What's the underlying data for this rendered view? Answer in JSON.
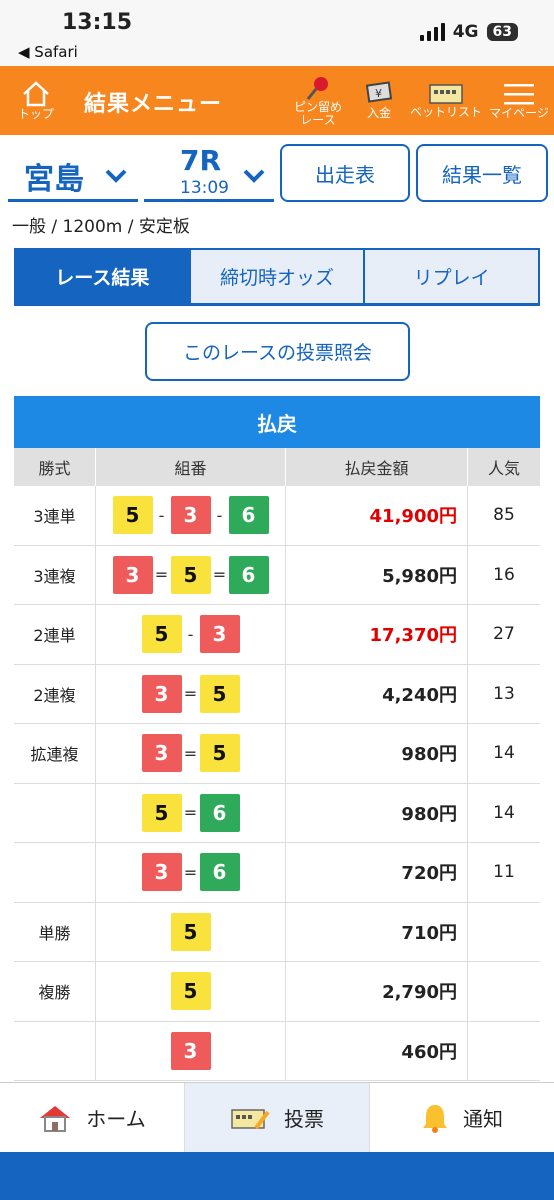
{
  "status": {
    "time": "13:15",
    "back": "◀ Safari",
    "network": "4G",
    "battery": "63"
  },
  "header": {
    "top": "トップ",
    "title": "結果メニュー",
    "pin": "ピン留め\nレース",
    "deposit": "入金",
    "betlist": "ベットリスト",
    "mypage": "マイページ"
  },
  "race": {
    "venue": "宮島",
    "race_no": "7R",
    "race_time": "13:09",
    "entries_button": "出走表",
    "results_button": "結果一覧",
    "info": "一般 / 1200m / 安定板"
  },
  "tabs": [
    "レース結果",
    "締切時オッズ",
    "リプレイ"
  ],
  "inquiry_button": "このレースの投票照会",
  "table": {
    "title": "払戻",
    "headers": [
      "勝式",
      "組番",
      "払戻金額",
      "人気"
    ],
    "rows": [
      {
        "type": "3連単",
        "combo": [
          "5",
          "-",
          "3",
          "-",
          "6"
        ],
        "amount": "41,900円",
        "pop": "85",
        "red": true
      },
      {
        "type": "3連複",
        "combo": [
          "3",
          "=",
          "5",
          "=",
          "6"
        ],
        "amount": "5,980円",
        "pop": "16",
        "red": false
      },
      {
        "type": "2連単",
        "combo": [
          "5",
          "-",
          "3"
        ],
        "amount": "17,370円",
        "pop": "27",
        "red": true
      },
      {
        "type": "2連複",
        "combo": [
          "3",
          "=",
          "5"
        ],
        "amount": "4,240円",
        "pop": "13",
        "red": false
      },
      {
        "type": "拡連複",
        "combo": [
          "3",
          "=",
          "5"
        ],
        "amount": "980円",
        "pop": "14",
        "red": false
      },
      {
        "type": "",
        "combo": [
          "5",
          "=",
          "6"
        ],
        "amount": "980円",
        "pop": "14",
        "red": false
      },
      {
        "type": "",
        "combo": [
          "3",
          "=",
          "6"
        ],
        "amount": "720円",
        "pop": "11",
        "red": false
      },
      {
        "type": "単勝",
        "combo": [
          "5"
        ],
        "amount": "710円",
        "pop": "",
        "red": false
      },
      {
        "type": "複勝",
        "combo": [
          "5"
        ],
        "amount": "2,790円",
        "pop": "",
        "red": false
      },
      {
        "type": "",
        "combo": [
          "3"
        ],
        "amount": "460円",
        "pop": "",
        "red": false
      }
    ]
  },
  "boat_colors": {
    "3": "#ef5a5a",
    "5": "#f9e23c",
    "6": "#2eaa5a"
  },
  "bottom_nav": {
    "home": "ホーム",
    "vote": "投票",
    "notify": "通知"
  }
}
